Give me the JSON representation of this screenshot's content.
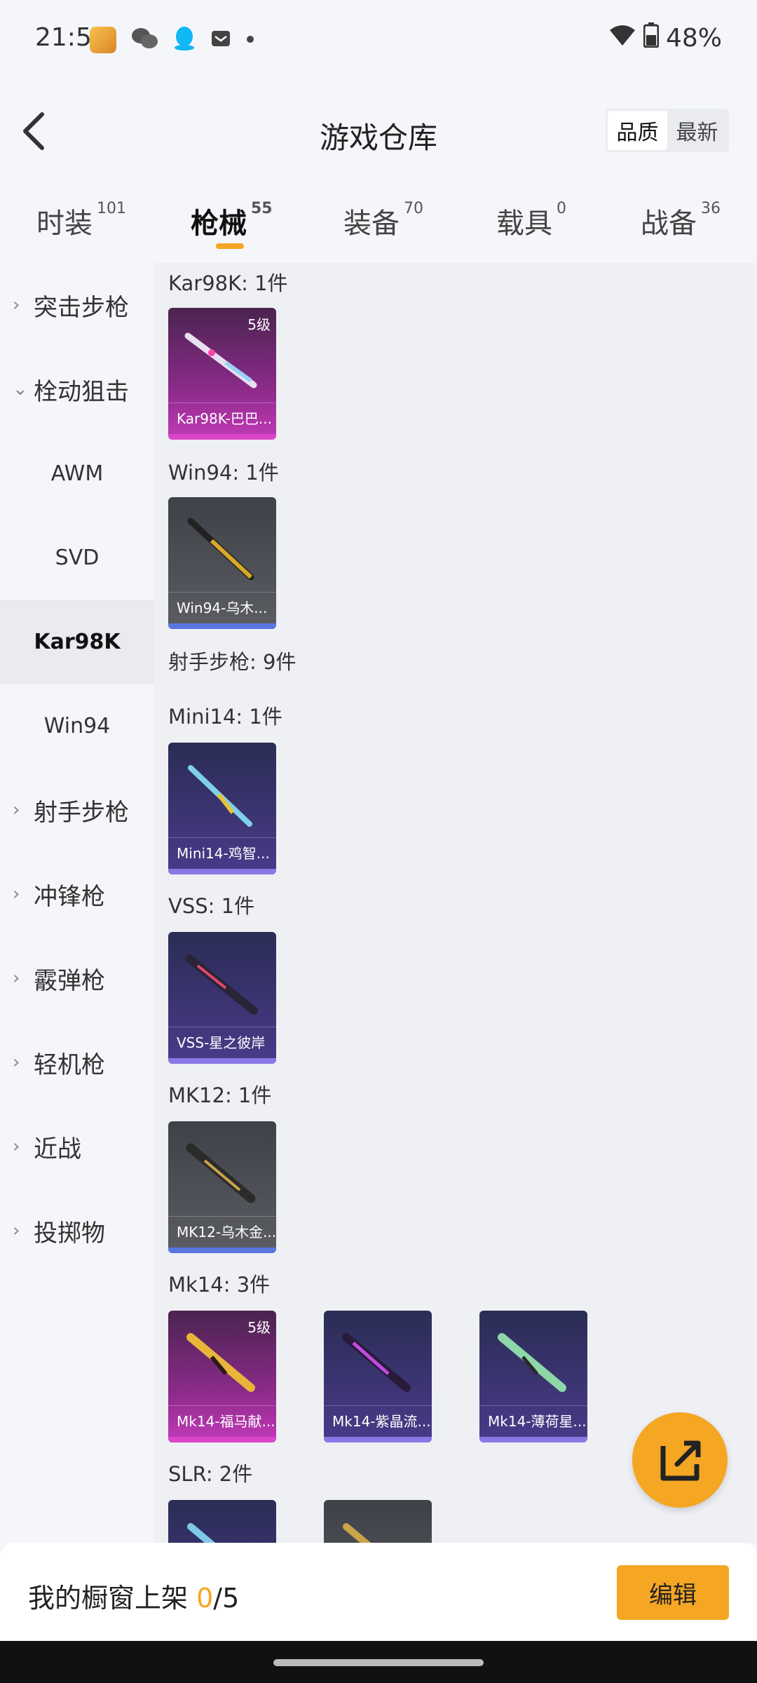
{
  "status": {
    "time": "21:51",
    "battery": "48%"
  },
  "header": {
    "title": "游戏仓库",
    "sort": [
      "品质",
      "最新"
    ]
  },
  "tabs": [
    {
      "label": "时装",
      "count": "101"
    },
    {
      "label": "枪械",
      "count": "55"
    },
    {
      "label": "装备",
      "count": "70"
    },
    {
      "label": "载具",
      "count": "0"
    },
    {
      "label": "战备",
      "count": "36"
    }
  ],
  "sidebar": {
    "items": [
      "突击步枪",
      "栓动狙击",
      "AWM",
      "SVD",
      "Kar98K",
      "Win94",
      "射手步枪",
      "冲锋枪",
      "霰弹枪",
      "轻机枪",
      "近战",
      "投掷物"
    ]
  },
  "content": {
    "groups": [
      {
        "label": "Kar98K: 1件",
        "cards": [
          {
            "name": "Kar98K-巴巴...",
            "level": "5级",
            "rarity": "pink"
          }
        ]
      },
      {
        "label": "Win94: 1件",
        "cards": [
          {
            "name": "Win94-乌木...",
            "rarity": "grey"
          }
        ]
      },
      {
        "label": "射手步枪: 9件"
      },
      {
        "label": "Mini14: 1件",
        "cards": [
          {
            "name": "Mini14-鸡智...",
            "rarity": "purple"
          }
        ]
      },
      {
        "label": "VSS: 1件",
        "cards": [
          {
            "name": "VSS-星之彼岸",
            "rarity": "purple"
          }
        ]
      },
      {
        "label": "MK12: 1件",
        "cards": [
          {
            "name": "MK12-乌木金...",
            "rarity": "grey"
          }
        ]
      },
      {
        "label": "Mk14: 3件",
        "cards": [
          {
            "name": "Mk14-福马献...",
            "level": "5级",
            "rarity": "pink"
          },
          {
            "name": "Mk14-紫晶流...",
            "rarity": "purple"
          },
          {
            "name": "Mk14-薄荷星...",
            "rarity": "purple"
          }
        ]
      },
      {
        "label": "SLR: 2件"
      }
    ]
  },
  "bottom": {
    "text": "我的橱窗上架",
    "current": "0",
    "total": "/5",
    "edit": "编辑"
  },
  "colors": {
    "accent": "#f5a623",
    "pink": "#d946c9",
    "blue": "#5876e0",
    "purple": "#8a78e6"
  }
}
